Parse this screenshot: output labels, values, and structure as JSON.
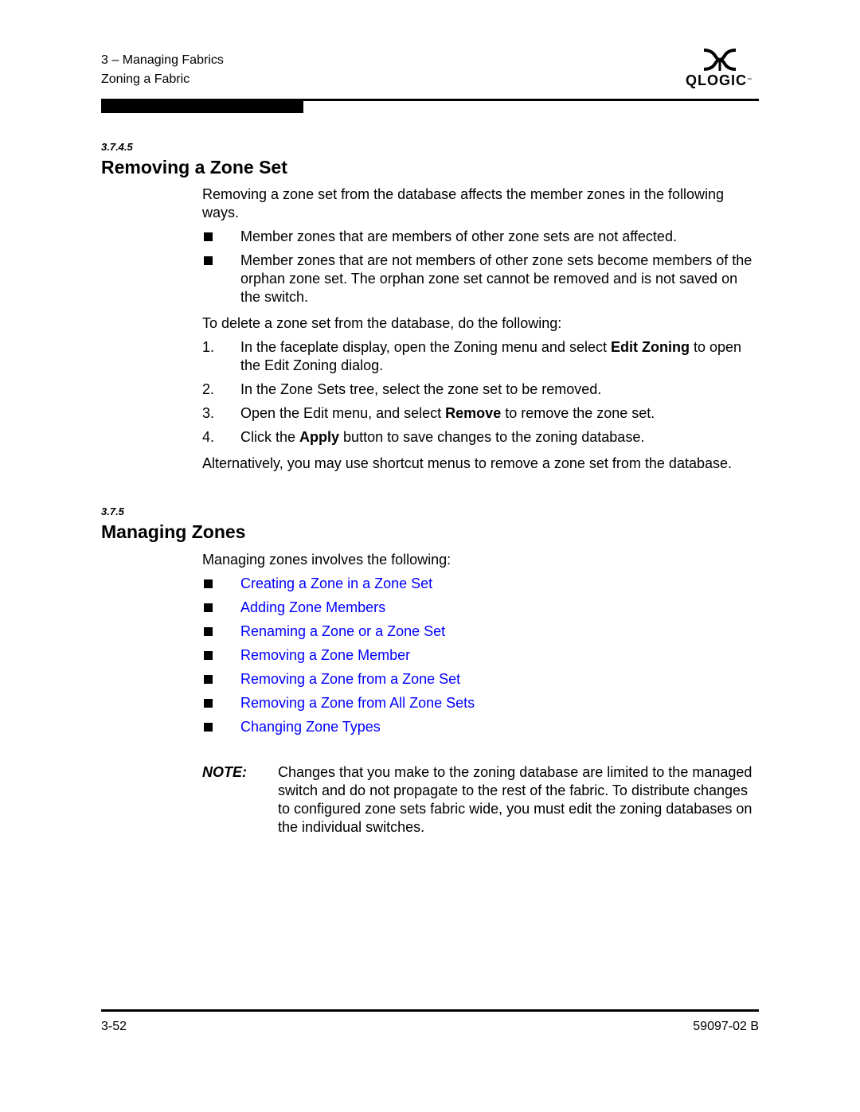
{
  "header": {
    "chapter": "3 – Managing Fabrics",
    "section": "Zoning a Fabric",
    "logo_text": "QLOGIC",
    "logo_tm": "™",
    "logo_icon": "qlogic-logo-icon"
  },
  "section1": {
    "number": "3.7.4.5",
    "title": "Removing a Zone Set",
    "intro": "Removing a zone set from the database affects the member zones in the following ways.",
    "bullets": [
      "Member zones that are members of other zone sets are not affected.",
      "Member zones that are not members of other zone sets become members of the orphan zone set. The orphan zone set cannot be removed and is not saved on the switch."
    ],
    "steps_intro": "To delete a zone set from the database, do the following:",
    "steps": [
      {
        "num": "1.",
        "pre": "In the faceplate display, open the Zoning menu and select ",
        "bold": "Edit Zoning",
        "post": " to open the Edit Zoning dialog."
      },
      {
        "num": "2.",
        "pre": "In the Zone Sets tree, select the zone set to be removed.",
        "bold": "",
        "post": ""
      },
      {
        "num": "3.",
        "pre": "Open the Edit menu, and select ",
        "bold": "Remove",
        "post": " to remove the zone set."
      },
      {
        "num": "4.",
        "pre": "Click the ",
        "bold": "Apply",
        "post": " button to save changes to the zoning database."
      }
    ],
    "alternative": "Alternatively, you may use shortcut menus to remove a zone set from the database."
  },
  "section2": {
    "number": "3.7.5",
    "title": "Managing Zones",
    "intro": "Managing zones involves the following:",
    "links": [
      "Creating a Zone in a Zone Set",
      "Adding Zone Members",
      "Renaming a Zone or a Zone Set",
      "Removing a Zone Member",
      "Removing a Zone from a Zone Set",
      "Removing a Zone from All Zone Sets",
      "Changing Zone Types"
    ],
    "link_color": "#0000ff"
  },
  "note": {
    "label": "NOTE:",
    "text": "Changes that you make to the zoning database are limited to the managed switch and do not propagate to the rest of the fabric. To distribute changes to configured zone sets fabric wide, you must edit the zoning databases on the individual switches."
  },
  "footer": {
    "page": "3-52",
    "doc_id": "59097-02 B"
  }
}
